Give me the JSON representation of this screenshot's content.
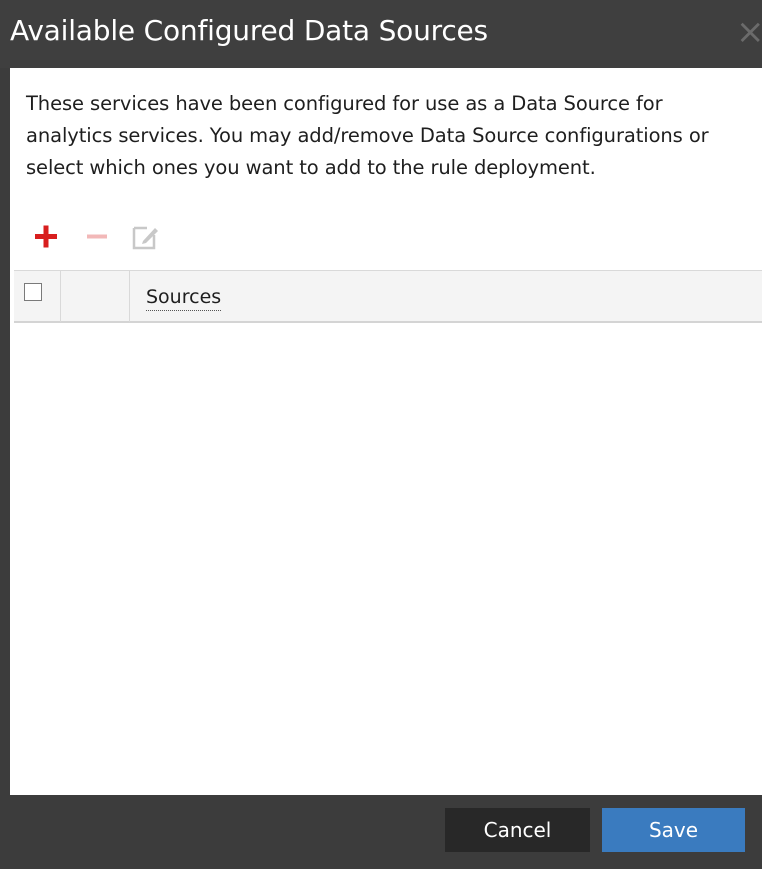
{
  "dialog": {
    "title": "Available Configured Data Sources",
    "close_label": "×"
  },
  "description": "These services have been configured for use as a Data Source for analytics services. You may add/remove Data Source configurations or select which ones you want to add to the rule deployment.",
  "toolbar": {
    "add_icon": "plus-icon",
    "remove_icon": "minus-icon",
    "edit_icon": "edit-icon",
    "colors": {
      "add": "#d81e1e",
      "remove_disabled": "#f2b8b8",
      "edit_disabled": "#c8c8c8"
    }
  },
  "grid": {
    "columns": [
      "",
      "",
      "Sources"
    ],
    "rows": []
  },
  "footer": {
    "cancel_label": "Cancel",
    "save_label": "Save"
  },
  "colors": {
    "titlebar": "#3f3f3f",
    "primary_button": "#3a7bbf",
    "secondary_button": "#282828"
  }
}
